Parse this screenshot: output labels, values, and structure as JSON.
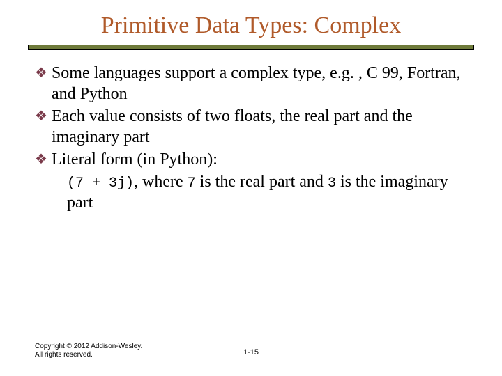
{
  "title": "Primitive Data Types: Complex",
  "bullets": [
    "Some languages support a complex type, e.g. , C 99, Fortran, and Python",
    "Each value consists of two floats, the real part and the imaginary part",
    "Literal form (in Python):"
  ],
  "literal": {
    "code1": "(7 + 3j)",
    "mid1": ", where ",
    "code2": "7",
    "mid2": " is the real part and ",
    "code3": "3",
    "tail": " is the imaginary part"
  },
  "footer": {
    "copyright": "Copyright © 2012 Addison-Wesley. All rights reserved.",
    "page": "1-15"
  }
}
